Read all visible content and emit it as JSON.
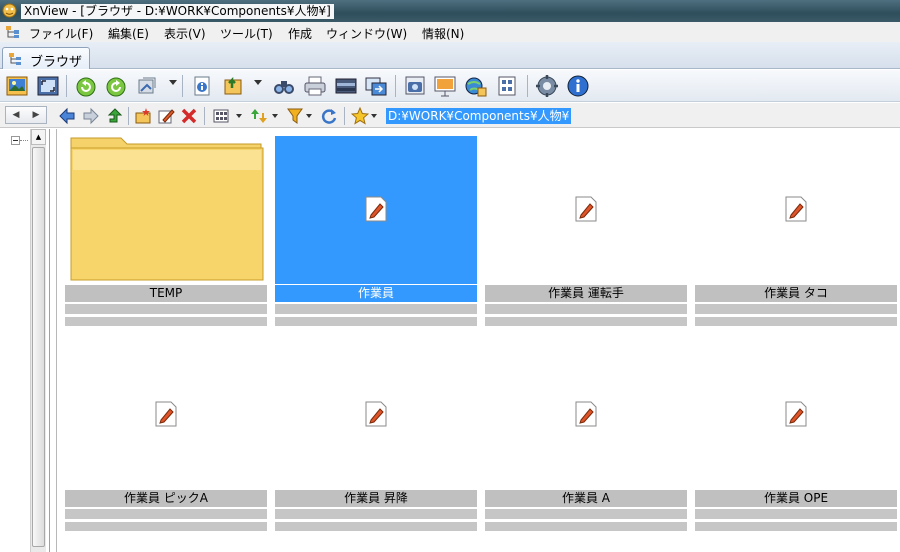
{
  "window": {
    "title": "XnView - [ブラウザ - D:¥WORK¥Components¥人物¥]"
  },
  "menu": [
    "ファイル(F)",
    "編集(E)",
    "表示(V)",
    "ツール(T)",
    "作成",
    "ウィンドウ(W)",
    "情報(N)"
  ],
  "tab": {
    "label": "ブラウザ"
  },
  "address": {
    "path": "D:¥WORK¥Components¥人物¥"
  },
  "thumbnails": [
    {
      "label": "TEMP",
      "kind": "folder",
      "selected": false
    },
    {
      "label": "作業員",
      "kind": "file",
      "selected": true
    },
    {
      "label": "作業員 運転手",
      "kind": "file",
      "selected": false
    },
    {
      "label": "作業員 タコ",
      "kind": "file",
      "selected": false
    },
    {
      "label": "作業員 ピックA",
      "kind": "file",
      "selected": false
    },
    {
      "label": "作業員 昇降",
      "kind": "file",
      "selected": false
    },
    {
      "label": "作業員 A",
      "kind": "file",
      "selected": false
    },
    {
      "label": "作業員 OPE",
      "kind": "file",
      "selected": false
    }
  ],
  "colors": {
    "selection": "#3399ff",
    "label_bg": "#c0c0c0"
  }
}
